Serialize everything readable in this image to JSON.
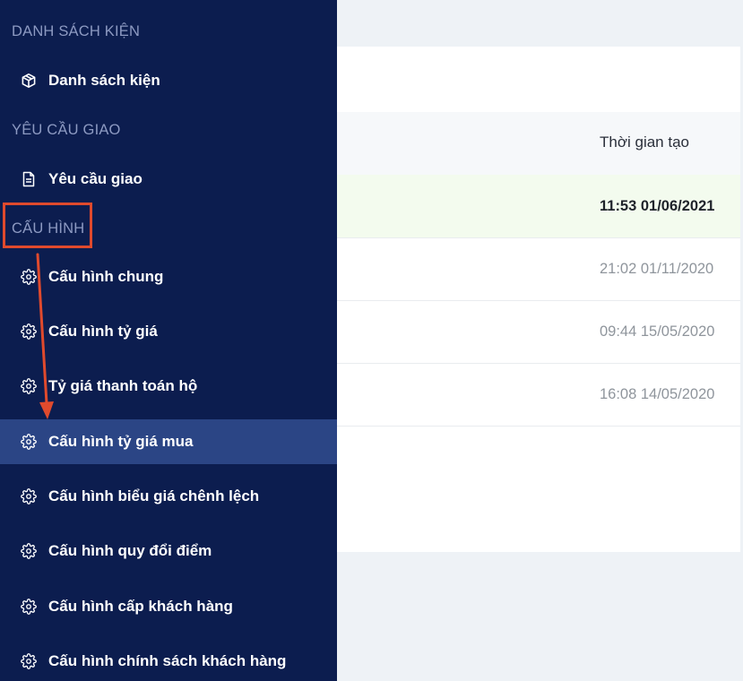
{
  "sidebar": {
    "sections": [
      {
        "label": "DANH SÁCH KIỆN"
      },
      {
        "label": "YÊU CẦU GIAO"
      },
      {
        "label": "CẤU HÌNH"
      }
    ],
    "items": [
      {
        "label": "Danh sách kiện",
        "icon": "package-icon"
      },
      {
        "label": "Yêu cầu giao",
        "icon": "document-icon"
      },
      {
        "label": "Cấu hình chung",
        "icon": "gear-icon"
      },
      {
        "label": "Cấu hình tỷ giá",
        "icon": "gear-icon"
      },
      {
        "label": "Tỷ giá thanh toán hộ",
        "icon": "gear-icon"
      },
      {
        "label": "Cấu hình tỷ giá mua",
        "icon": "gear-icon",
        "active": true
      },
      {
        "label": "Cấu hình biểu giá chênh lệch",
        "icon": "gear-icon"
      },
      {
        "label": "Cấu hình quy đổi điểm",
        "icon": "gear-icon"
      },
      {
        "label": "Cấu hình cấp khách hàng",
        "icon": "gear-icon"
      },
      {
        "label": "Cấu hình chính sách khách hàng",
        "icon": "gear-icon"
      }
    ]
  },
  "table": {
    "columns": [
      "Thời gian tạo"
    ],
    "rows": [
      {
        "created_at": "11:53 01/06/2021",
        "highlighted": true
      },
      {
        "created_at": "21:02 01/11/2020"
      },
      {
        "created_at": "09:44 15/05/2020"
      },
      {
        "created_at": "16:08 14/05/2020"
      }
    ]
  },
  "colors": {
    "sidebar_bg": "#0c1d4f",
    "active_item_bg": "#2b4585",
    "section_label": "#8d9ac2",
    "annotation": "#e04a2d",
    "highlight_row_bg": "#f3fbee"
  }
}
